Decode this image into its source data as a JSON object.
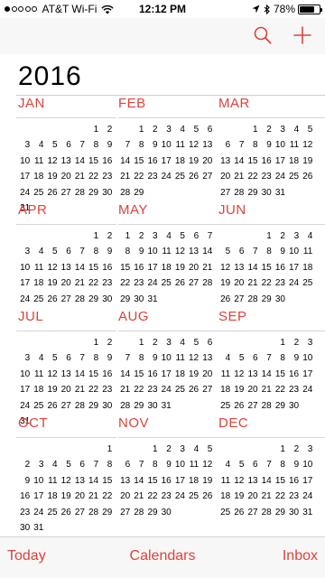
{
  "status_bar": {
    "signal_dots": [
      true,
      false,
      false,
      false,
      false
    ],
    "carrier": "AT&T Wi-Fi",
    "time": "12:12 PM",
    "battery": "78%",
    "battery_level": 0.78
  },
  "nav": {
    "search_icon": "search-icon",
    "add_icon": "plus-icon"
  },
  "year": "2016",
  "accent_color": "#e0413a",
  "months": [
    {
      "name": "JAN",
      "weeks": [
        [
          "",
          "",
          "",
          "",
          "",
          1,
          2
        ],
        [
          3,
          4,
          5,
          6,
          7,
          8,
          9
        ],
        [
          10,
          11,
          12,
          13,
          14,
          15,
          16
        ],
        [
          17,
          18,
          19,
          20,
          21,
          22,
          23
        ],
        [
          24,
          25,
          26,
          27,
          28,
          29,
          30
        ],
        [
          31
        ]
      ]
    },
    {
      "name": "FEB",
      "weeks": [
        [
          "",
          1,
          2,
          3,
          4,
          5,
          6
        ],
        [
          7,
          8,
          9,
          10,
          11,
          12,
          13
        ],
        [
          14,
          15,
          16,
          17,
          18,
          19,
          20
        ],
        [
          21,
          22,
          23,
          24,
          25,
          26,
          27
        ],
        [
          28,
          29
        ]
      ]
    },
    {
      "name": "MAR",
      "weeks": [
        [
          "",
          "",
          1,
          2,
          3,
          4,
          5
        ],
        [
          6,
          7,
          8,
          9,
          10,
          11,
          12
        ],
        [
          13,
          14,
          15,
          16,
          17,
          18,
          19
        ],
        [
          20,
          21,
          22,
          23,
          24,
          25,
          26
        ],
        [
          27,
          28,
          29,
          30,
          31
        ]
      ]
    },
    {
      "name": "APR",
      "weeks": [
        [
          "",
          "",
          "",
          "",
          "",
          1,
          2
        ],
        [
          3,
          4,
          5,
          6,
          7,
          8,
          9
        ],
        [
          10,
          11,
          12,
          13,
          14,
          15,
          16
        ],
        [
          17,
          18,
          19,
          20,
          21,
          22,
          23
        ],
        [
          24,
          25,
          26,
          27,
          28,
          29,
          30
        ]
      ]
    },
    {
      "name": "MAY",
      "weeks": [
        [
          1,
          2,
          3,
          4,
          5,
          6,
          7
        ],
        [
          8,
          9,
          10,
          11,
          12,
          13,
          14
        ],
        [
          15,
          16,
          17,
          18,
          19,
          20,
          21
        ],
        [
          22,
          23,
          24,
          25,
          26,
          27,
          28
        ],
        [
          29,
          30,
          31
        ]
      ]
    },
    {
      "name": "JUN",
      "weeks": [
        [
          "",
          "",
          "",
          1,
          2,
          3,
          4
        ],
        [
          5,
          6,
          7,
          8,
          9,
          10,
          11
        ],
        [
          12,
          13,
          14,
          15,
          16,
          17,
          18
        ],
        [
          19,
          20,
          21,
          22,
          23,
          24,
          25
        ],
        [
          26,
          27,
          28,
          29,
          30
        ]
      ]
    },
    {
      "name": "JUL",
      "weeks": [
        [
          "",
          "",
          "",
          "",
          "",
          1,
          2
        ],
        [
          3,
          4,
          5,
          6,
          7,
          8,
          9
        ],
        [
          10,
          11,
          12,
          13,
          14,
          15,
          16
        ],
        [
          17,
          18,
          19,
          20,
          21,
          22,
          23
        ],
        [
          24,
          25,
          26,
          27,
          28,
          29,
          30
        ],
        [
          31
        ]
      ]
    },
    {
      "name": "AUG",
      "weeks": [
        [
          "",
          1,
          2,
          3,
          4,
          5,
          6
        ],
        [
          7,
          8,
          9,
          10,
          11,
          12,
          13
        ],
        [
          14,
          15,
          16,
          17,
          18,
          19,
          20
        ],
        [
          21,
          22,
          23,
          24,
          25,
          26,
          27
        ],
        [
          28,
          29,
          30,
          31
        ]
      ]
    },
    {
      "name": "SEP",
      "weeks": [
        [
          "",
          "",
          "",
          "",
          1,
          2,
          3
        ],
        [
          4,
          5,
          6,
          7,
          8,
          9,
          10
        ],
        [
          11,
          12,
          13,
          14,
          15,
          16,
          17
        ],
        [
          18,
          19,
          20,
          21,
          22,
          23,
          24
        ],
        [
          25,
          26,
          27,
          28,
          29,
          30
        ]
      ]
    },
    {
      "name": "OCT",
      "weeks": [
        [
          "",
          "",
          "",
          "",
          "",
          "",
          1
        ],
        [
          2,
          3,
          4,
          5,
          6,
          7,
          8
        ],
        [
          9,
          10,
          11,
          12,
          13,
          14,
          15
        ],
        [
          16,
          17,
          18,
          19,
          20,
          21,
          22
        ],
        [
          23,
          24,
          25,
          26,
          27,
          28,
          29
        ],
        [
          30,
          31
        ]
      ]
    },
    {
      "name": "NOV",
      "weeks": [
        [
          "",
          "",
          1,
          2,
          3,
          4,
          5
        ],
        [
          6,
          7,
          8,
          9,
          10,
          11,
          12
        ],
        [
          13,
          14,
          15,
          16,
          17,
          18,
          19
        ],
        [
          20,
          21,
          22,
          23,
          24,
          25,
          26
        ],
        [
          27,
          28,
          29,
          30
        ]
      ]
    },
    {
      "name": "DEC",
      "weeks": [
        [
          "",
          "",
          "",
          "",
          1,
          2,
          3
        ],
        [
          4,
          5,
          6,
          7,
          8,
          9,
          10
        ],
        [
          11,
          12,
          13,
          14,
          15,
          16,
          17
        ],
        [
          18,
          19,
          20,
          21,
          22,
          23,
          24
        ],
        [
          25,
          26,
          27,
          28,
          29,
          30,
          31
        ]
      ]
    }
  ],
  "tab_bar": {
    "today": "Today",
    "calendars": "Calendars",
    "inbox": "Inbox"
  }
}
